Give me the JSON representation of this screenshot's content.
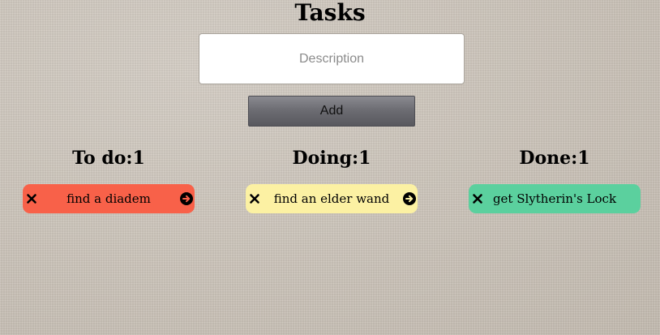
{
  "header": {
    "title": "Tasks"
  },
  "form": {
    "description_placeholder": "Description",
    "description_value": "",
    "add_label": "Add"
  },
  "columns": [
    {
      "heading": "To do:1",
      "color": "#f86149",
      "cards": [
        {
          "text": "find a diadem",
          "icons": [
            "close-icon",
            "arrow-right-circle-icon"
          ]
        }
      ]
    },
    {
      "heading": "Doing:1",
      "color": "#fcf1a3",
      "cards": [
        {
          "text": "find an elder wand",
          "icons": [
            "close-icon",
            "arrow-right-circle-icon"
          ]
        }
      ]
    },
    {
      "heading": "Done:1",
      "color": "#5bd09e",
      "cards": [
        {
          "text": "get Slytherin's Lock",
          "icons": [
            "close-icon"
          ]
        }
      ]
    }
  ]
}
